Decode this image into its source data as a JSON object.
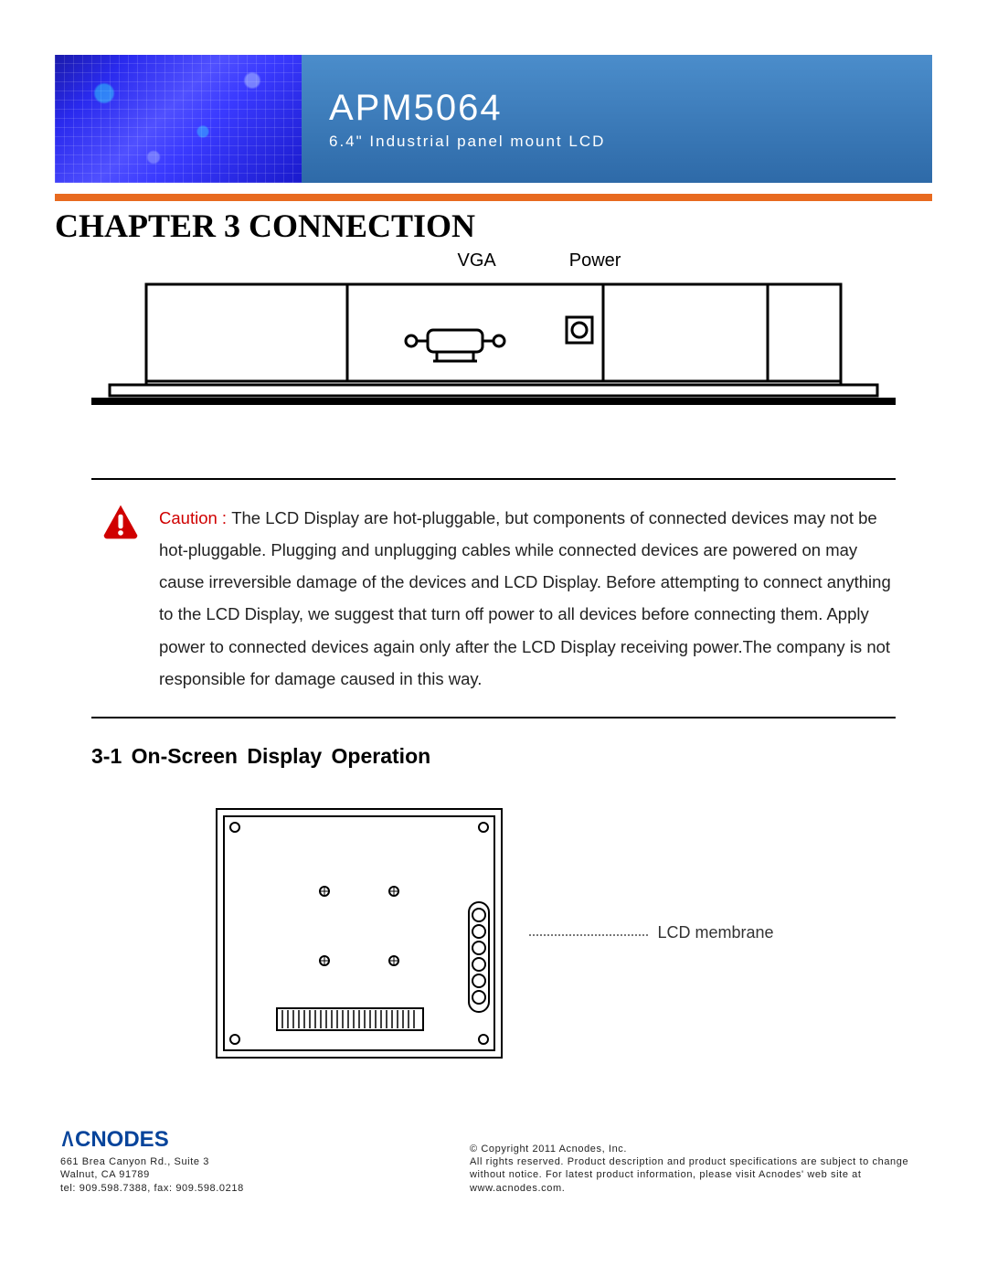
{
  "header": {
    "model": "APM5064",
    "description": "6.4\" Industrial panel mount LCD"
  },
  "chapter_title": "CHAPTER 3 CONNECTION",
  "ports": {
    "vga": "VGA",
    "power": "Power"
  },
  "caution": {
    "label": "Caution : ",
    "text": "The LCD Display are hot-pluggable, but components of connected devices may not be hot-pluggable. Plugging and unplugging cables while connected devices are powered on may cause irreversible damage of the devices and LCD Display. Before attempting to connect anything to the LCD Display, we suggest that turn off power to all devices before connecting them. Apply power to connected devices again only after the LCD Display receiving power.The company is not responsible for damage caused in this way."
  },
  "section_3_1": "3-1  On-Screen Display Operation",
  "lcd_membrane_label": "LCD membrane",
  "footer": {
    "logo": "ACNODES",
    "address_line1": "661 Brea Canyon Rd., Suite 3",
    "address_line2": "Walnut, CA 91789",
    "contact": "tel: 909.598.7388, fax: 909.598.0218",
    "copyright": "© Copyright 2011 Acnodes, Inc.",
    "rights": "All rights reserved. Product description and product specifications are subject to change without notice. For latest product information, please visit Acnodes' web site at www.acnodes.com."
  }
}
